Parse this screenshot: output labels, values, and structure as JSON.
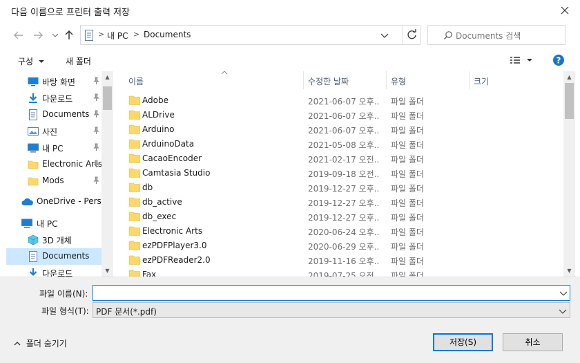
{
  "window": {
    "title": "다음 이름으로 프린터 출력 저장"
  },
  "address": {
    "crumbs": [
      "내 PC",
      "Documents"
    ]
  },
  "search": {
    "placeholder": "Documents 검색"
  },
  "toolbar": {
    "organize": "구성",
    "new_folder": "새 폴더"
  },
  "sidebar": {
    "items": [
      {
        "label": "바탕 화면",
        "icon": "desktop-icon",
        "pinned": true
      },
      {
        "label": "다운로드",
        "icon": "download-icon",
        "pinned": true
      },
      {
        "label": "Documents",
        "icon": "document-icon",
        "pinned": true
      },
      {
        "label": "사진",
        "icon": "picture-icon",
        "pinned": true
      },
      {
        "label": "내 PC",
        "icon": "pc-icon",
        "pinned": true
      },
      {
        "label": "Electronic Arts",
        "icon": "folder-icon",
        "pinned": true
      },
      {
        "label": "Mods",
        "icon": "folder-icon",
        "pinned": true
      },
      {
        "label": "OneDrive - Personal",
        "icon": "cloud-icon",
        "pinned": false
      },
      {
        "label": "내 PC",
        "icon": "pc-icon",
        "pinned": false
      },
      {
        "label": "3D 개체",
        "icon": "cube-icon",
        "pinned": false
      },
      {
        "label": "Documents",
        "icon": "document-icon",
        "pinned": false,
        "selected": true
      },
      {
        "label": "다운로드",
        "icon": "download-icon",
        "pinned": false
      }
    ]
  },
  "columns": {
    "name": "이름",
    "date": "수정한 날짜",
    "type": "유형",
    "size": "크기"
  },
  "files": [
    {
      "name": "Adobe",
      "date": "2021-06-07 오후...",
      "type": "파일 폴더"
    },
    {
      "name": "ALDrive",
      "date": "2021-06-07 오후...",
      "type": "파일 폴더"
    },
    {
      "name": "Arduino",
      "date": "2021-06-07 오후...",
      "type": "파일 폴더"
    },
    {
      "name": "ArduinoData",
      "date": "2021-05-08 오후...",
      "type": "파일 폴더"
    },
    {
      "name": "CacaoEncoder",
      "date": "2021-02-17 오전...",
      "type": "파일 폴더"
    },
    {
      "name": "Camtasia Studio",
      "date": "2019-09-18 오전...",
      "type": "파일 폴더"
    },
    {
      "name": "db",
      "date": "2019-12-27 오후...",
      "type": "파일 폴더"
    },
    {
      "name": "db_active",
      "date": "2019-12-27 오후...",
      "type": "파일 폴더"
    },
    {
      "name": "db_exec",
      "date": "2019-12-27 오후...",
      "type": "파일 폴더"
    },
    {
      "name": "Electronic Arts",
      "date": "2020-06-24 오후...",
      "type": "파일 폴더"
    },
    {
      "name": "ezPDFPlayer3.0",
      "date": "2020-06-29 오후...",
      "type": "파일 폴더"
    },
    {
      "name": "ezPDFReader2.0",
      "date": "2019-11-16 오후...",
      "type": "파일 폴더"
    },
    {
      "name": "Fax",
      "date": "2019-07-25 오전...",
      "type": "파일 폴더"
    }
  ],
  "form": {
    "filename_label": "파일 이름(N):",
    "filename_value": "",
    "filetype_label": "파일 형식(T):",
    "filetype_value": "PDF 문서(*.pdf)"
  },
  "footer": {
    "hide_folders": "폴더 숨기기",
    "save": "저장(S)",
    "cancel": "취소"
  },
  "colors": {
    "accent": "#0078d7",
    "folder": "#ffd86a",
    "selected": "#cce8ff"
  }
}
